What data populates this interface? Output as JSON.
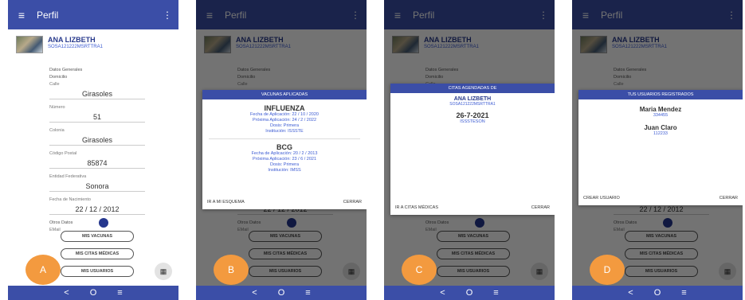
{
  "common": {
    "app_title": "Perfil",
    "menu_icon": "hamburger-menu-icon",
    "more_icon": "kebab-menu-icon",
    "qr_icon": "qr-code-icon",
    "profile": {
      "name": "ANA LIZBETH",
      "curp": "SOSA121222MSRTTRA1"
    },
    "buttons": {
      "vacunas": "MIS VACUNAS",
      "citas": "MIS CITAS MÉDICAS",
      "usuarios": "MIS USUARIOS"
    },
    "nav": {
      "back": "<",
      "home": "O",
      "recents": "≡"
    }
  },
  "screenA": {
    "label": "A",
    "fields": [
      {
        "label": "Datos Generales",
        "value": ""
      },
      {
        "label": "Domicilio",
        "value": ""
      },
      {
        "label": "Calle",
        "value": "Girasoles"
      },
      {
        "label": "Número",
        "value": "51"
      },
      {
        "label": "Colonia",
        "value": "Girasoles"
      },
      {
        "label": "Código Postal",
        "value": "85874"
      },
      {
        "label": "Entidad Federativa",
        "value": "Sonora"
      },
      {
        "label": "Fecha de Nacimiento",
        "value": "22 / 12 / 2012"
      }
    ],
    "otros": "Otros Datos",
    "email": "EMail"
  },
  "screenB": {
    "label": "B",
    "dialog_title": "VACUNAS APLICADAS",
    "vaccines": [
      {
        "name": "INFLUENZA",
        "applied": "Fecha de Aplicación: 22 / 10 / 2020",
        "next": "Próxima Aplicación: 24 / 2 / 2022",
        "dose": "Dosis: Primera",
        "inst": "Institución: ISSSTE"
      },
      {
        "name": "BCG",
        "applied": "Fecha de Aplicación: 20 / 2 / 2013",
        "next": "Próxima Aplicación: 23 / 6 / 2021",
        "dose": "Dosis: Primera",
        "inst": "Institución: IMSS"
      }
    ],
    "left_action": "IR A MI ESQUEMA",
    "right_action": "CERRAR"
  },
  "screenC": {
    "label": "C",
    "dialog_title": "CITAS AGENDADAS DE",
    "name": "ANA LIZBETH",
    "curp": "SOSA121222MSRTTRA1",
    "date": "26-7-2021",
    "place": "ISSSTESON",
    "left_action": "IR A CITAS MÉDICAS",
    "right_action": "CERRAR"
  },
  "screenD": {
    "label": "D",
    "dialog_title": "TUS USUARIOS REGISTRADOS",
    "users": [
      {
        "name": "Maria Mendez",
        "id": "334455"
      },
      {
        "name": "Juan Claro",
        "id": "112233"
      }
    ],
    "left_action": "CREAR USUARIO",
    "right_action": "CERRAR"
  }
}
